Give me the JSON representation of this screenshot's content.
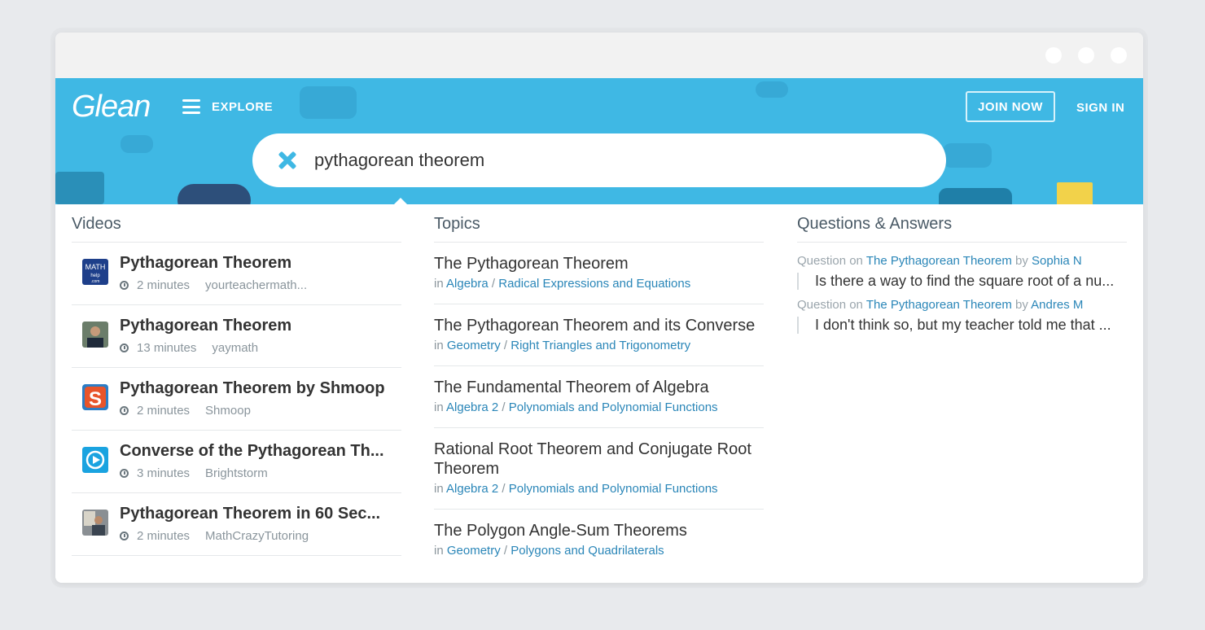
{
  "header": {
    "logo": "Glean",
    "explore_label": "EXPLORE",
    "join_label": "JOIN NOW",
    "signin_label": "SIGN IN"
  },
  "search": {
    "value": "pythagorean theorem"
  },
  "videos": {
    "heading": "Videos",
    "items": [
      {
        "title": "Pythagorean Theorem",
        "duration": "2 minutes",
        "channel": "yourteachermath...",
        "thumb_icon": "mathhelp-logo-icon"
      },
      {
        "title": "Pythagorean Theorem",
        "duration": "13 minutes",
        "channel": "yaymath",
        "thumb_icon": "teacher-avatar-icon"
      },
      {
        "title": "Pythagorean Theorem by Shmoop",
        "duration": "2 minutes",
        "channel": "Shmoop",
        "thumb_icon": "shmoop-logo-icon"
      },
      {
        "title": "Converse of the Pythagorean Th...",
        "duration": "3 minutes",
        "channel": "Brightstorm",
        "thumb_icon": "play-circle-icon"
      },
      {
        "title": "Pythagorean Theorem in 60 Sec...",
        "duration": "2 minutes",
        "channel": "MathCrazyTutoring",
        "thumb_icon": "tutor-avatar-icon"
      }
    ]
  },
  "topics": {
    "heading": "Topics",
    "in_label": "in",
    "items": [
      {
        "title": "The Pythagorean Theorem",
        "subject": "Algebra",
        "section": "Radical Expressions and Equations"
      },
      {
        "title": "The Pythagorean Theorem and its Converse",
        "subject": "Geometry",
        "section": "Right Triangles and Trigonometry"
      },
      {
        "title": "The Fundamental Theorem of Algebra",
        "subject": "Algebra 2",
        "section": "Polynomials and Polynomial Functions"
      },
      {
        "title": "Rational Root Theorem and Conjugate Root Theorem",
        "subject": "Algebra 2",
        "section": "Polynomials and Polynomial Functions"
      },
      {
        "title": "The Polygon Angle-Sum Theorems",
        "subject": "Geometry",
        "section": "Polygons and Quadrilaterals"
      }
    ]
  },
  "qa": {
    "heading": "Questions & Answers",
    "items": [
      {
        "kind": "Question",
        "on": "on",
        "topic": "The Pythagorean Theorem",
        "by": "by",
        "author": "Sophia N",
        "text": "Is there a way to find the square root of a nu..."
      },
      {
        "kind": "Question",
        "on": "on",
        "topic": "The Pythagorean Theorem",
        "by": "by",
        "author": "Andres M",
        "text": "I don't think so, but my teacher told me that ..."
      }
    ]
  },
  "colors": {
    "accent": "#3fb8e4",
    "link": "#2a86b8"
  }
}
